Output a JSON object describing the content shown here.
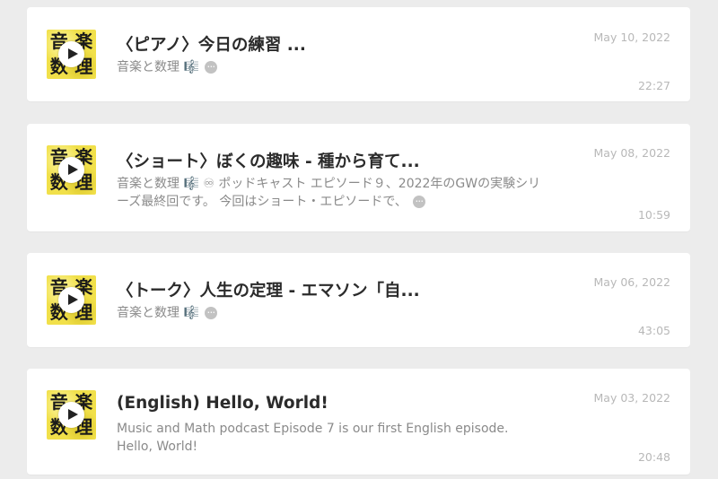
{
  "thumbnail": {
    "chars": [
      "音",
      "楽",
      "数",
      "理"
    ],
    "background": "#f1e04a",
    "icon": "play-icon"
  },
  "more_icon": "more-dots-icon",
  "episodes": [
    {
      "title": "〈ピアノ〉今日の練習 ...",
      "description": "音楽と数理 🎼",
      "date": "May 10, 2022",
      "duration": "22:27"
    },
    {
      "title": "〈ショート〉ぼくの趣味 - 種から育て...",
      "description": "音楽と数理 🎼 ♾ ポッドキャスト エピソード９、2022年のGWの実験シリーズ最終回です。 今回はショート・エピソードで、",
      "date": "May 08, 2022",
      "duration": "10:59"
    },
    {
      "title": "〈トーク〉人生の定理 - エマソン「自...",
      "description": "音楽と数理 🎼",
      "date": "May 06, 2022",
      "duration": "43:05"
    },
    {
      "title": "(English) Hello, World!",
      "description": "Music and Math podcast Episode 7 is our first English episode. Hello, World!",
      "date": "May 03, 2022",
      "duration": "20:48"
    }
  ]
}
